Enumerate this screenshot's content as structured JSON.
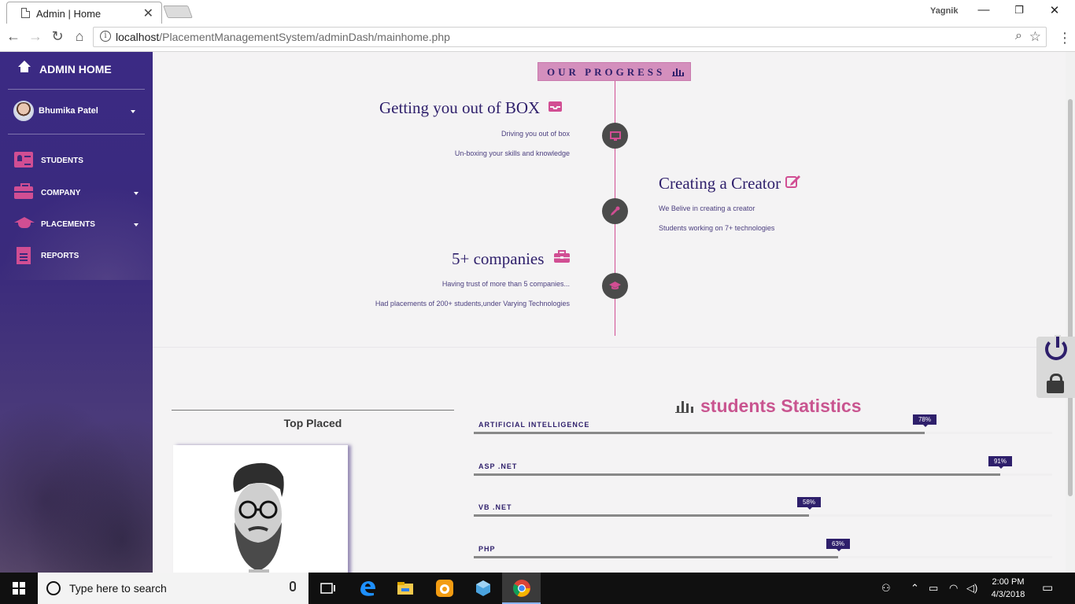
{
  "browser": {
    "tab_title": "Admin | Home",
    "tab_close": "✕",
    "profile_name": "Yagnik",
    "url_host": "localhost",
    "url_path": "/PlacementManagementSystem/adminDash/mainhome.php",
    "info_glyph": "i"
  },
  "sidebar": {
    "home_label": "ADMIN HOME",
    "user_name": "Bhumika Patel",
    "items": [
      {
        "label": "STUDENTS",
        "icon": "id-card-icon",
        "has_caret": false
      },
      {
        "label": "COMPANY",
        "icon": "briefcase-icon",
        "has_caret": true
      },
      {
        "label": "PLACEMENTS",
        "icon": "graduation-cap-icon",
        "has_caret": true
      },
      {
        "label": "REPORTS",
        "icon": "file-text-icon",
        "has_caret": false
      }
    ]
  },
  "progress": {
    "badge": "OUR PROGRESS",
    "entries": [
      {
        "heading": "Getting you out of BOX",
        "lines": [
          "Driving you out of box",
          "Un-boxing your skills and knowledge"
        ],
        "icon": "inbox-icon",
        "node_icon": "monitor-icon"
      },
      {
        "heading": "Creating a Creator",
        "lines": [
          "We Belive in creating a creator",
          "Students working on 7+ technologies"
        ],
        "icon": "edit-icon",
        "node_icon": "eyedropper-icon"
      },
      {
        "heading": "5+ companies",
        "lines": [
          "Having trust of more than 5 companies...",
          "Had placements of 200+ students,under Varying Technologies"
        ],
        "icon": "briefcase-icon",
        "node_icon": "graduation-cap-icon"
      }
    ]
  },
  "top_placed": {
    "title": "Top Placed"
  },
  "stats": {
    "title": "students Statistics",
    "skills": [
      {
        "name": "ARTIFICIAL INTELLIGENCE",
        "percent": 78,
        "label": "78%"
      },
      {
        "name": "ASP .NET",
        "percent": 91,
        "label": "91%"
      },
      {
        "name": "VB .NET",
        "percent": 58,
        "label": "58%"
      },
      {
        "name": "PHP",
        "percent": 63,
        "label": "63%"
      }
    ]
  },
  "taskbar": {
    "search_placeholder": "Type here to search",
    "time": "2:00 PM",
    "date": "4/3/2018"
  },
  "colors": {
    "accent": "#d14e93",
    "primary": "#2e1f6b",
    "sidebar_bg": "#3b2a84"
  }
}
